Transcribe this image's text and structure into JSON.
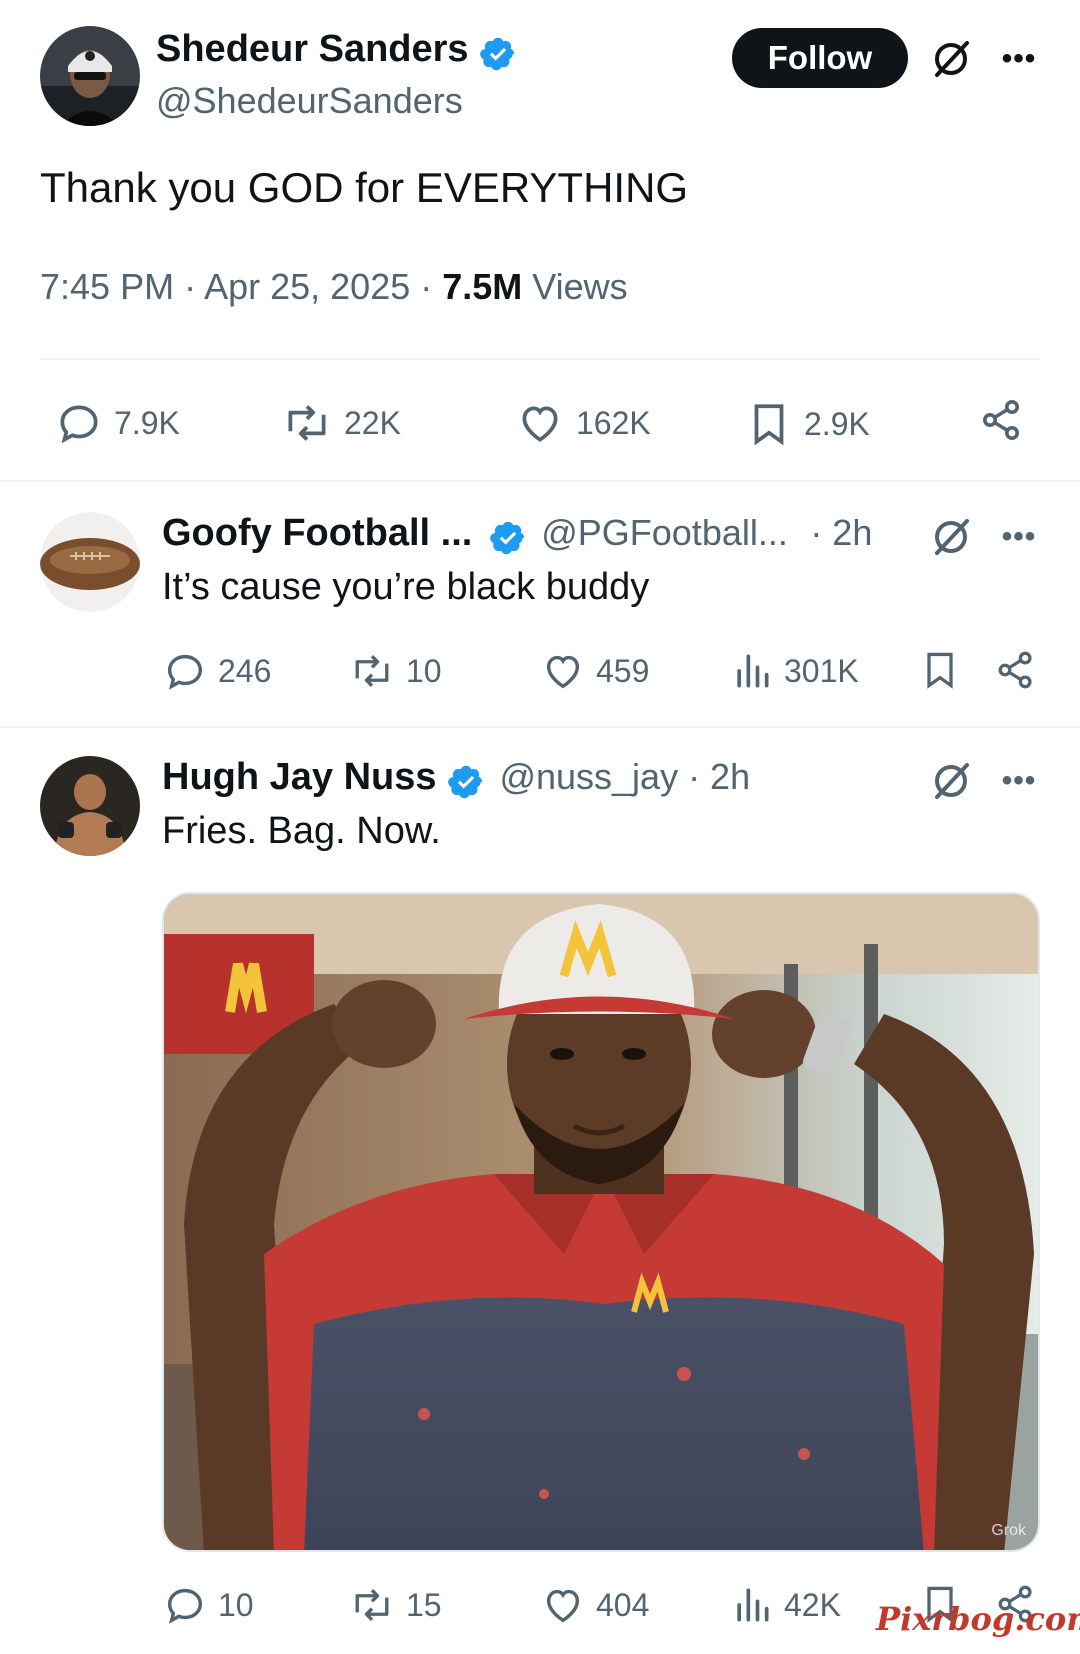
{
  "main_tweet": {
    "name": "Shedeur Sanders",
    "handle": "@ShedeurSanders",
    "follow_label": "Follow",
    "text": "Thank you GOD for EVERYTHING",
    "time": "7:45 PM · Apr 25, 2025 · ",
    "views_count": "7.5M",
    "views_label": " Views",
    "replies": "7.9K",
    "reposts": "22K",
    "likes": "162K",
    "bookmarks": "2.9K"
  },
  "replies": [
    {
      "name": "Goofy Football ...",
      "handle": "@PGFootball...",
      "time": "· 2h",
      "text": "It’s cause you’re black buddy",
      "replies": "246",
      "reposts": "10",
      "likes": "459",
      "views": "301K"
    },
    {
      "name": "Hugh Jay Nuss",
      "handle": "@nuss_jay · 2h",
      "text": "Fries. Bag. Now.",
      "image_watermark": "Grok",
      "replies": "10",
      "reposts": "15",
      "likes": "404",
      "views": "42K"
    }
  ],
  "site_watermark": "Pixrbog.com",
  "colors": {
    "text": "#0f1419",
    "secondary": "#536471",
    "verified": "#1d9bf0",
    "divider": "#eff3f4",
    "watermark": "#c0392b"
  }
}
